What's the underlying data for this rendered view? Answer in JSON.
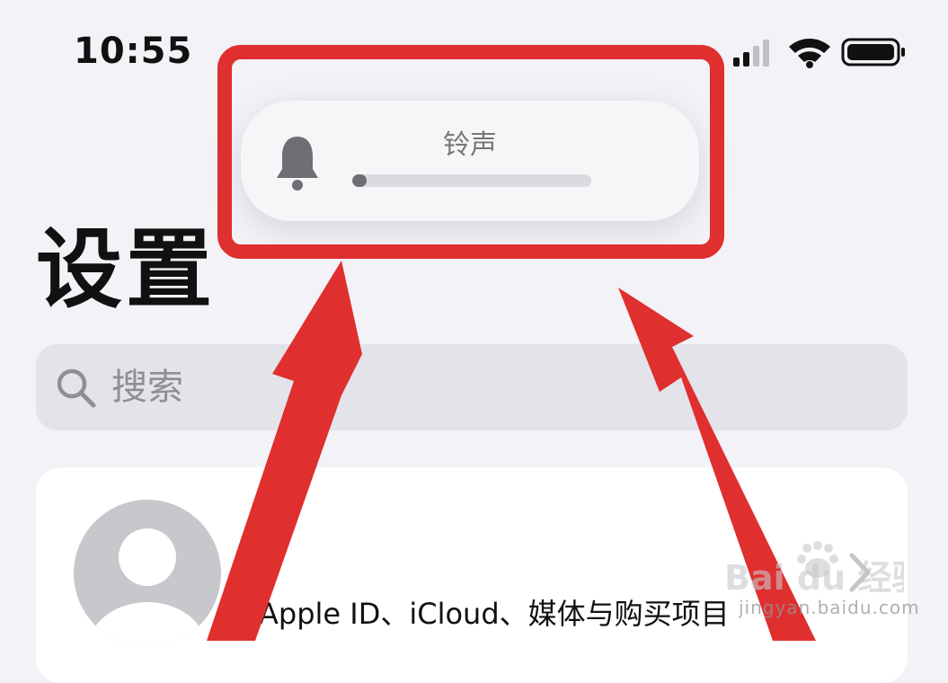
{
  "status_bar": {
    "time": "10:55",
    "icons": [
      "cellular-signal-icon",
      "wifi-icon",
      "battery-icon"
    ]
  },
  "volume_hud": {
    "title": "铃声",
    "icon": "bell-icon",
    "level_fraction": 0.06
  },
  "page": {
    "title": "设置"
  },
  "search": {
    "placeholder": "搜索",
    "icon": "search-icon"
  },
  "account": {
    "subtitle": "Apple ID、iCloud、媒体与购买项目",
    "icon": "avatar-icon"
  },
  "watermark": {
    "brand": "Bai du 经验",
    "url": "jingyan.baidu.com"
  },
  "colors": {
    "annotation_red": "#e02f2f",
    "background": "#f2f2f7",
    "card": "#ffffff"
  }
}
